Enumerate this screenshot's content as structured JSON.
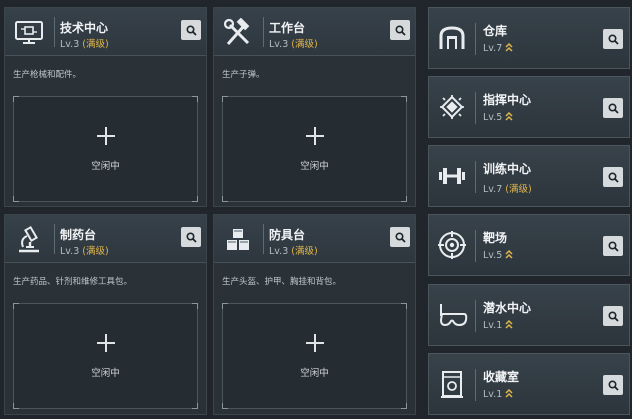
{
  "workshops": [
    {
      "name": "技术中心",
      "level": "Lv.3",
      "max": "(满级)",
      "desc": "生产枪械和配件。",
      "slot": "空闲中",
      "icon": "monitor-cpu-icon"
    },
    {
      "name": "工作台",
      "level": "Lv.3",
      "max": "(满级)",
      "desc": "生产子弹。",
      "slot": "空闲中",
      "icon": "hammer-wrench-icon"
    },
    {
      "name": "制药台",
      "level": "Lv.3",
      "max": "(满级)",
      "desc": "生产药品、针剂和维修工具包。",
      "slot": "空闲中",
      "icon": "microscope-icon"
    },
    {
      "name": "防具台",
      "level": "Lv.3",
      "max": "(满级)",
      "desc": "生产头盔、护甲、胸挂和背包。",
      "slot": "空闲中",
      "icon": "cubes-icon"
    }
  ],
  "facilities": [
    {
      "name": "仓库",
      "level": "Lv.7",
      "max": "",
      "icon": "warehouse-icon"
    },
    {
      "name": "指挥中心",
      "level": "Lv.5",
      "max": "",
      "icon": "command-chip-icon"
    },
    {
      "name": "训练中心",
      "level": "Lv.7",
      "max": "(满级)",
      "icon": "dumbbell-icon"
    },
    {
      "name": "靶场",
      "level": "Lv.5",
      "max": "",
      "icon": "target-icon"
    },
    {
      "name": "潜水中心",
      "level": "Lv.1",
      "max": "",
      "icon": "diving-mask-icon"
    },
    {
      "name": "收藏室",
      "level": "Lv.1",
      "max": "",
      "icon": "display-case-icon"
    }
  ],
  "colors": {
    "accent": "#e0b54c",
    "panel": "#2a3237",
    "background": "#20262b"
  }
}
